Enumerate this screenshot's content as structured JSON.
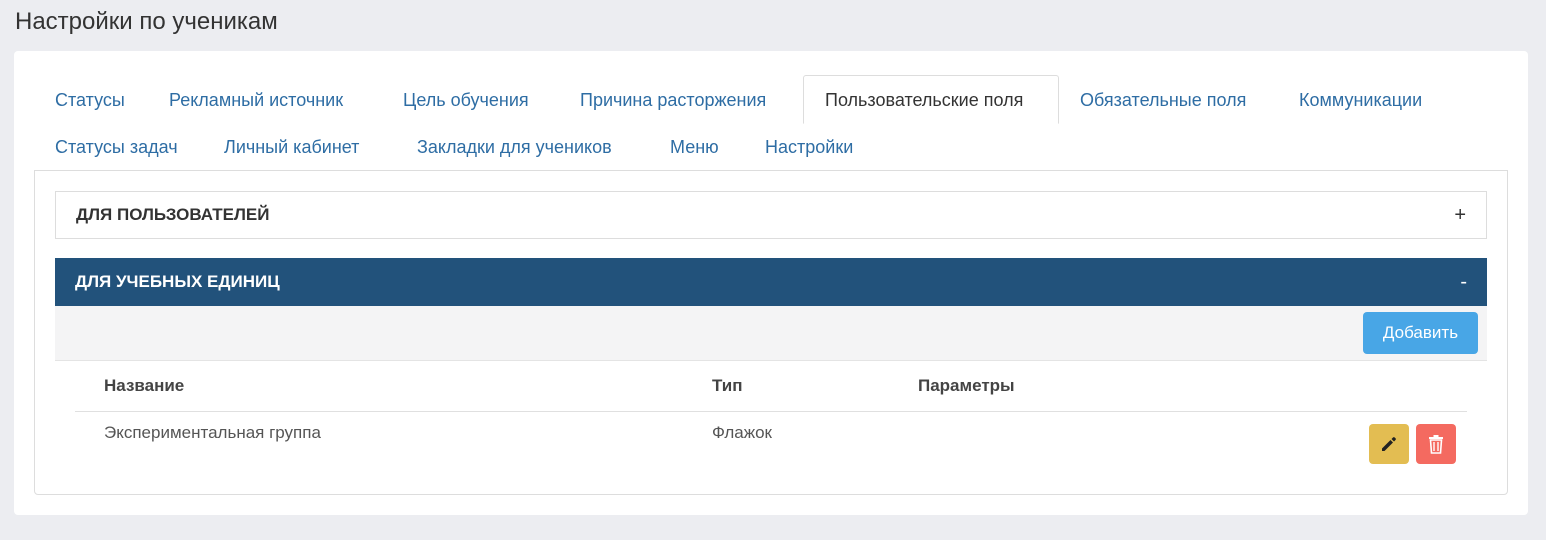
{
  "page": {
    "title": "Настройки по ученикам"
  },
  "tabs": [
    {
      "label": "Статусы"
    },
    {
      "label": "Рекламный источник"
    },
    {
      "label": "Цель обучения"
    },
    {
      "label": "Причина расторжения"
    },
    {
      "label": "Пользовательские поля",
      "active": true
    },
    {
      "label": "Обязательные поля"
    },
    {
      "label": "Коммуникации"
    },
    {
      "label": "Статусы задач"
    },
    {
      "label": "Личный кабинет"
    },
    {
      "label": "Закладки для учеников"
    },
    {
      "label": "Меню"
    },
    {
      "label": "Настройки"
    }
  ],
  "panels": {
    "users": {
      "title": "ДЛЯ ПОЛЬЗОВАТЕЛЕЙ",
      "toggle": "+"
    },
    "units": {
      "title": "ДЛЯ УЧЕБНЫХ ЕДИНИЦ",
      "toggle": "-"
    }
  },
  "toolbar": {
    "add_label": "Добавить"
  },
  "table": {
    "columns": [
      "Название",
      "Тип",
      "Параметры"
    ],
    "rows": [
      {
        "name": "Экспериментальная группа",
        "type": "Флажок",
        "params": ""
      }
    ]
  },
  "icons": {
    "edit": "pencil-icon",
    "delete": "trash-icon"
  },
  "colors": {
    "accent": "#22527b",
    "link": "#2e6da4",
    "add_button": "#48a6e6",
    "edit_button": "#e3bd52",
    "delete_button": "#f46a60"
  }
}
